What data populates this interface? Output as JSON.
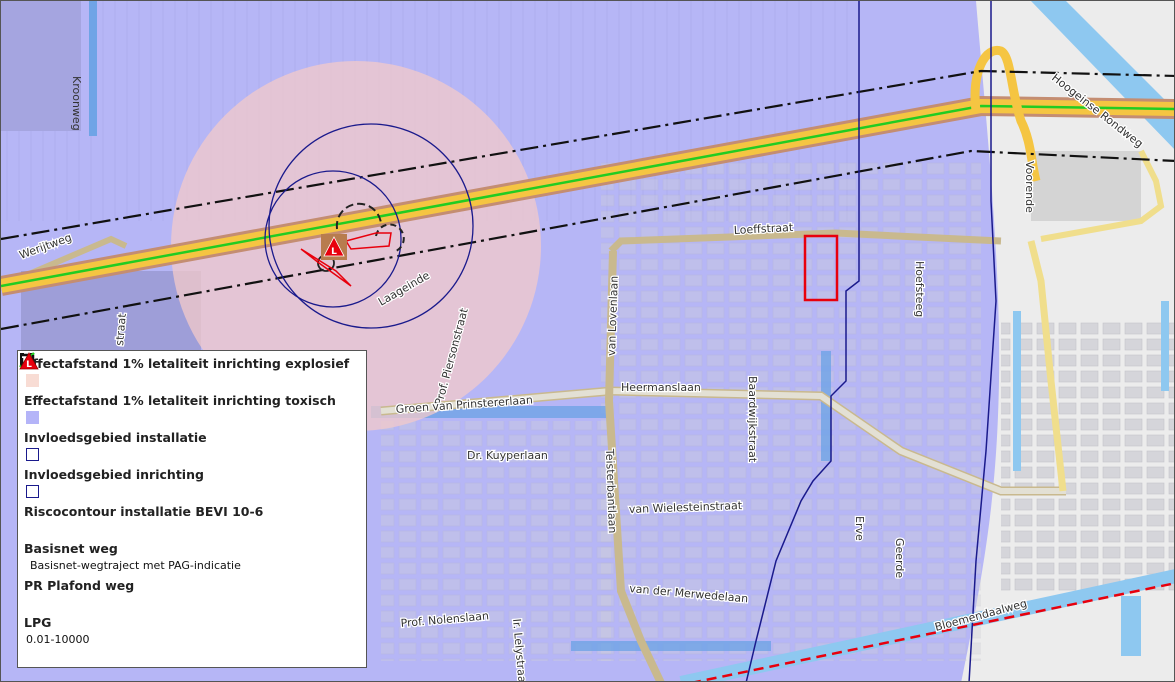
{
  "map": {
    "streets": {
      "kroonweg": "Kroonweg",
      "weijtweg": "Werijtweg",
      "laageinde": "Laageinde",
      "piersonstraat": "Prof. Piersonstraat",
      "loeffstraat": "Loeffstraat",
      "van_lovenlaan": "van Lovenlaan",
      "heermanslaan": "Heermanslaan",
      "groen_van_prinstererlaan": "Groen van Prinstererlaan",
      "baardwijkstraat": "Baardwijkstraat",
      "hoefsteeg": "Hoefsteeg",
      "voorende": "Voorende",
      "hoogeinse_rondweg": "Hoogeinse Rondweg",
      "dr_kuyperlaan": "Dr. Kuyperlaan",
      "teisterbantlaan": "Teisterbantlaan",
      "van_wielesteinstraat": "van Wielesteinstraat",
      "erve": "Erve",
      "geerde": "Geerde",
      "van_der_merwedelaan": "van der Merwedelaan",
      "prof_nolenslaan": "Prof. Nolenslaan",
      "ir_lelystraat": "Ir. Lelystraat",
      "bloemendaalweg": "Bloemendaalweg",
      "straat_partial": "straat"
    },
    "colors": {
      "toxic_zone": "#b8b8f5",
      "explosive_zone": "#f3c9c9",
      "influence_outline": "#1a1a8c",
      "pag_road": "#22cc22",
      "highway": "#f5c542",
      "water": "#8ec8f0",
      "risk_outline": "#e8000d"
    }
  },
  "legend": {
    "items": [
      {
        "title": "Effectafstand 1% letaliteit inrichting explosief",
        "swatch": "fill",
        "color": "#f8dcd4"
      },
      {
        "title": "Effectafstand 1% letaliteit inrichting toxisch",
        "swatch": "fill",
        "color": "#b4b4f8"
      },
      {
        "title": "Invloedsgebied installatie",
        "swatch": "box"
      },
      {
        "title": "Invloedsgebied inrichting",
        "swatch": "box"
      },
      {
        "title": "Riscocontour installatie BEVI 10-6",
        "swatch": "bracket"
      },
      {
        "title": "Basisnet weg",
        "swatch": "line",
        "sub": "Basisnet-wegtraject met PAG-indicatie"
      },
      {
        "title": "PR Plafond weg",
        "swatch": "plafond"
      },
      {
        "title": "LPG",
        "swatch": "lpg",
        "sub": "0.01-10000"
      }
    ]
  }
}
